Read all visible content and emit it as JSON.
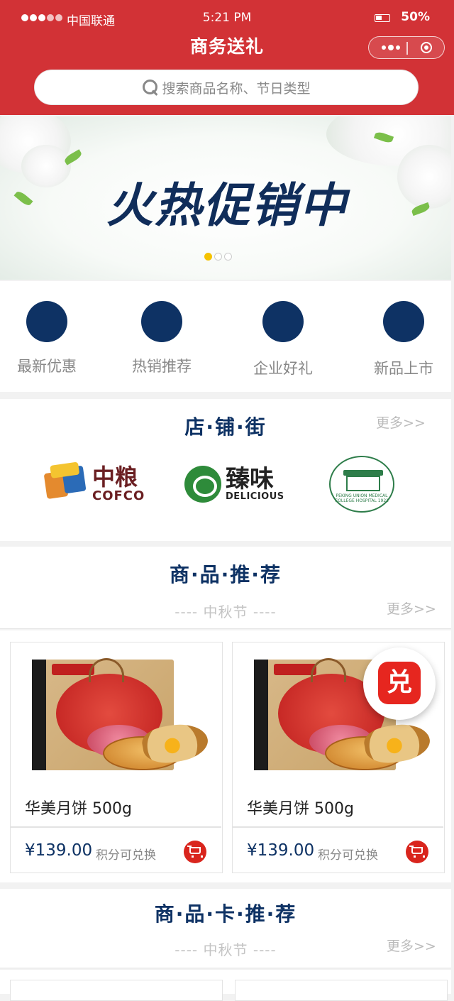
{
  "status_bar": {
    "carrier": "中国联通",
    "time": "5:21 PM",
    "battery": "50%"
  },
  "nav": {
    "title": "商务送礼"
  },
  "search": {
    "placeholder": "搜索商品名称、节日类型"
  },
  "banner": {
    "text": "火热促销中",
    "slide_count": 3,
    "active_slide": 1
  },
  "quick_nav": [
    {
      "label": "最新优惠"
    },
    {
      "label": "热销推荐"
    },
    {
      "label": "企业好礼"
    },
    {
      "label": "新品上市"
    }
  ],
  "stores": {
    "title": "店·铺·街",
    "more": "更多>>",
    "logos": [
      {
        "cn": "中粮",
        "en": "COFCO"
      },
      {
        "cn": "臻味",
        "en": "DELICIOUS"
      },
      {
        "caption": "PEKING UNION MEDICAL COLLEGE HOSPITAL 1921"
      }
    ]
  },
  "recommend": {
    "title": "商·品·推·荐",
    "subtitle": "----  中秋节  ----",
    "more": "更多>>",
    "products": [
      {
        "name": "华美月饼 500g",
        "price": "¥139.00",
        "note": "积分可兑换"
      },
      {
        "name": "华美月饼 500g",
        "price": "¥139.00",
        "note": "积分可兑换"
      }
    ],
    "exchange_badge": "兑"
  },
  "card_recommend": {
    "title": "商·品·卡·推·荐",
    "subtitle": "----  中秋节  ----",
    "more": "更多>>"
  },
  "colors": {
    "header": "#d23236",
    "accent_navy": "#0e3264",
    "cart_red": "#d9251d"
  }
}
